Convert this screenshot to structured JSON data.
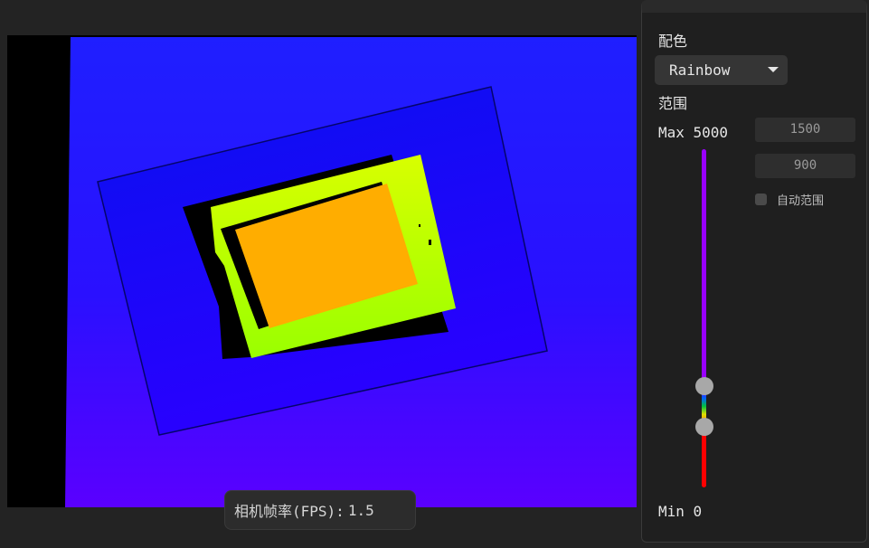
{
  "viewer": {
    "colormap_preview": "depth-rainbow"
  },
  "fps": {
    "label": "相机帧率(FPS):",
    "value": "1.5"
  },
  "panel": {
    "colormap_title": "配色",
    "colormap_selected": "Rainbow",
    "range_title": "范围",
    "max_label": "Max 5000",
    "min_label": "Min 0",
    "range_max_value": "1500",
    "range_min_value": "900",
    "auto_range_label": "自动范围",
    "auto_range_checked": false,
    "slider_upper_fraction": 0.3,
    "slider_lower_fraction": 0.18
  },
  "icons": {
    "dropdown": "chevron-down-icon",
    "collapse": "collapse-arrow-icon"
  },
  "colors": {
    "background": "#232323",
    "panel": "#1f1f1f",
    "slider_top": "#9900ff",
    "slider_bottom": "#ff0000"
  }
}
